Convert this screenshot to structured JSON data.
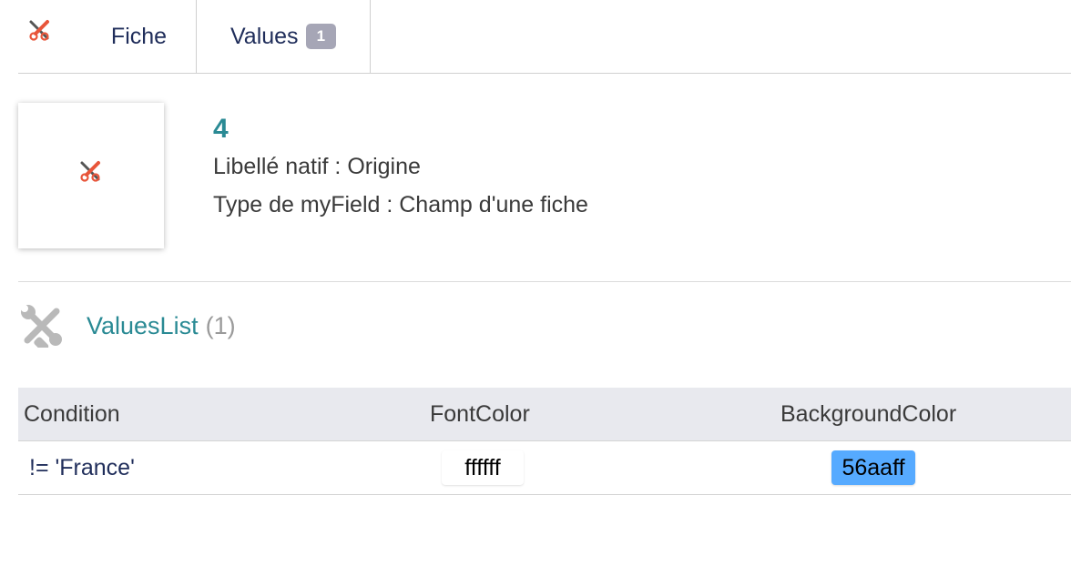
{
  "tabs": {
    "fiche_label": "Fiche",
    "values_label": "Values",
    "values_badge": "1"
  },
  "record": {
    "number": "4",
    "native_label_line": "Libellé natif : Origine",
    "field_type_line": "Type de myField : Champ d'une fiche"
  },
  "section": {
    "title": "ValuesList",
    "count": "(1)"
  },
  "table": {
    "columns": [
      "Condition",
      "FontColor",
      "BackgroundColor"
    ],
    "rows": [
      {
        "condition": "!= 'France'",
        "font_color": "ffffff",
        "background_color": "56aaff"
      }
    ]
  },
  "colors": {
    "accent_teal": "#2a8a94",
    "badge_grey": "#a6a6b6",
    "header_bg": "#e8e9ee",
    "swatch_blue": "#56aaff"
  },
  "icons": {
    "tab_icon": "tools-icon",
    "thumbnail_icon": "tools-icon",
    "section_icon": "wrench-screwdriver-icon"
  }
}
